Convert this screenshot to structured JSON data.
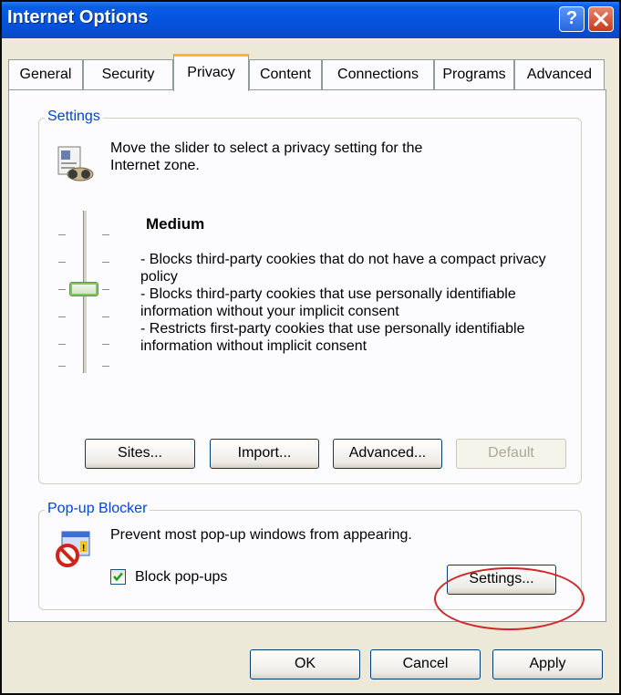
{
  "window": {
    "title": "Internet Options",
    "help_label": "?",
    "close_label": "X"
  },
  "tabs": [
    {
      "label": "General"
    },
    {
      "label": "Security"
    },
    {
      "label": "Privacy",
      "selected": true
    },
    {
      "label": "Content"
    },
    {
      "label": "Connections"
    },
    {
      "label": "Programs"
    },
    {
      "label": "Advanced"
    }
  ],
  "settings": {
    "legend": "Settings",
    "intro": "Move the slider to select a privacy setting for the Internet zone.",
    "level_title": "Medium",
    "level_description": [
      "- Blocks third-party cookies that do not have a compact privacy policy",
      "- Blocks third-party cookies that use personally identifiable information without your implicit consent",
      "- Restricts first-party cookies that use personally identifiable information without implicit consent"
    ],
    "slider_levels": 6,
    "slider_selected_index": 3,
    "buttons": {
      "sites": "Sites...",
      "import": "Import...",
      "advanced": "Advanced...",
      "default": "Default"
    }
  },
  "popup_blocker": {
    "legend": "Pop-up Blocker",
    "description": "Prevent most pop-up windows from appearing.",
    "checkbox_label": "Block pop-ups",
    "checked": true,
    "settings_button": "Settings...",
    "highlight_color": "#d4242a"
  },
  "footer": {
    "ok": "OK",
    "cancel": "Cancel",
    "apply": "Apply"
  },
  "colors": {
    "title_bar": "#0555e0",
    "legend_text": "#0046d5",
    "dialog_bg": "#ece9d8",
    "active_tab_accent": "#f5b730"
  }
}
